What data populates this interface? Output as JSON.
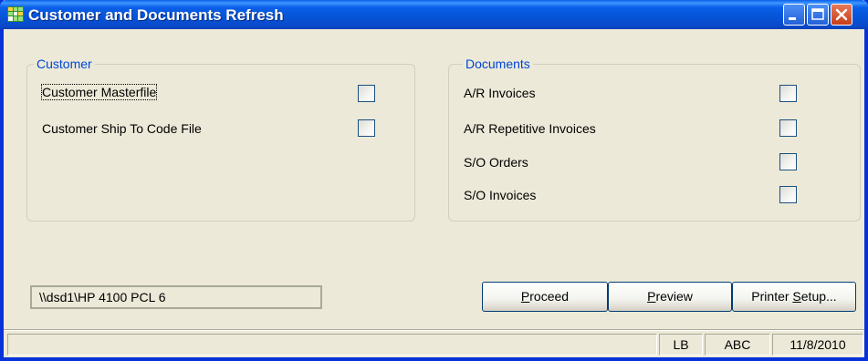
{
  "window": {
    "title": "Customer and Documents Refresh",
    "icon": "app-grid-icon"
  },
  "customer_group": {
    "label": "Customer",
    "items": [
      {
        "label": "Customer Masterfile",
        "checked": false
      },
      {
        "label": "Customer Ship To Code File",
        "checked": false
      }
    ]
  },
  "documents_group": {
    "label": "Documents",
    "items": [
      {
        "label": "A/R Invoices",
        "checked": false
      },
      {
        "label": "A/R Repetitive Invoices",
        "checked": false
      },
      {
        "label": "S/O Orders",
        "checked": false
      },
      {
        "label": "S/O Invoices",
        "checked": false
      }
    ]
  },
  "printer": {
    "value": "\\\\dsd1\\HP 4100 PCL 6"
  },
  "buttons": {
    "proceed_accel": "P",
    "proceed_rest": "roceed",
    "preview_accel": "P",
    "preview_rest": "review",
    "printer_setup_pre": "Printer ",
    "printer_setup_accel": "S",
    "printer_setup_rest": "etup..."
  },
  "statusbar": {
    "panel_main": "",
    "user": "LB",
    "company": "ABC",
    "date": "11/8/2010"
  },
  "colors": {
    "titlebar": "#0a5fe8",
    "dialog_bg": "#ece9d8",
    "group_label": "#0046d5"
  }
}
